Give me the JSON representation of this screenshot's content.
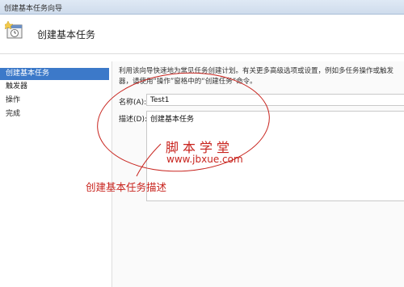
{
  "window": {
    "title": "创建基本任务向导"
  },
  "header": {
    "heading": "创建基本任务"
  },
  "sidebar": {
    "steps": [
      {
        "label": "创建基本任务"
      },
      {
        "label": "触发器"
      },
      {
        "label": "操作"
      },
      {
        "label": "完成"
      }
    ]
  },
  "form": {
    "intro_line1": "利用该向导快速地为常见任务创建计划。有关更多高级选项或设置，例如多任务操作或触发",
    "intro_line2": "器，请使用“操作”窗格中的“创建任务”命令。",
    "name_label": "名称(A):",
    "name_value": "Test1",
    "description_label": "描述(D):",
    "description_value": "创建基本任务"
  },
  "watermark": {
    "text": "脚本学堂",
    "url": "www.jbxue.com"
  },
  "annotation": {
    "text": "创建基本任务描述",
    "color": "#c8241e"
  },
  "colors": {
    "selected_step": "#3c79c9",
    "annotation": "#c8241e"
  }
}
